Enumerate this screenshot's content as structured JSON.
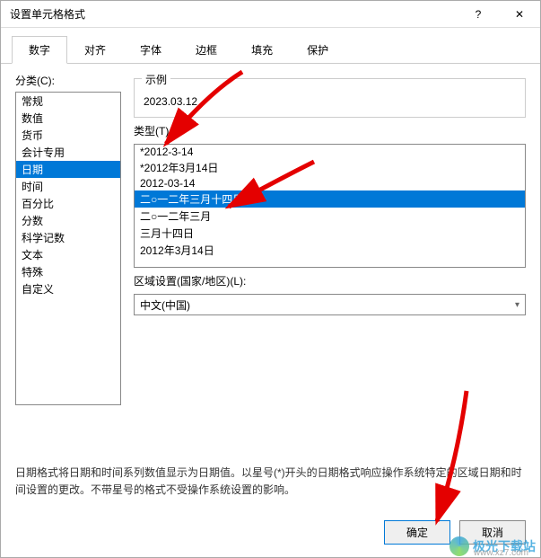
{
  "dialog_title": "设置单元格格式",
  "tabs": [
    "数字",
    "对齐",
    "字体",
    "边框",
    "填充",
    "保护"
  ],
  "active_tab_index": 0,
  "category_label": "分类(C):",
  "categories": [
    "常规",
    "数值",
    "货币",
    "会计专用",
    "日期",
    "时间",
    "百分比",
    "分数",
    "科学记数",
    "文本",
    "特殊",
    "自定义"
  ],
  "selected_category_index": 4,
  "example_label": "示例",
  "example_value": "2023.03.12",
  "type_label": "类型(T):",
  "types": [
    "*2012-3-14",
    "*2012年3月14日",
    "2012-03-14",
    "二○一二年三月十四日",
    "二○一二年三月",
    "三月十四日",
    "2012年3月14日"
  ],
  "selected_type_index": 3,
  "locale_label": "区域设置(国家/地区)(L):",
  "locale_value": "中文(中国)",
  "description_text": "日期格式将日期和时间系列数值显示为日期值。以星号(*)开头的日期格式响应操作系统特定的区域日期和时间设置的更改。不带星号的格式不受操作系统设置的影响。",
  "ok_label": "确定",
  "cancel_label": "取消",
  "watermark": {
    "brand": "极光下载站",
    "url": "www.xz7.com"
  }
}
